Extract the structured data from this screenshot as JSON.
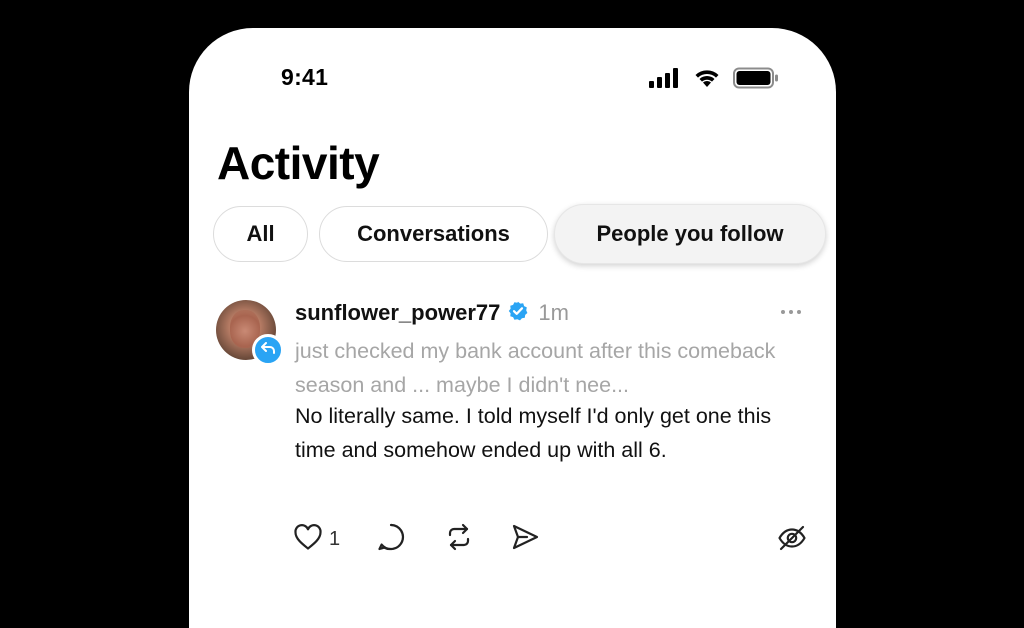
{
  "status_bar": {
    "time": "9:41",
    "icons": [
      "cellular-signal-icon",
      "wifi-icon",
      "battery-icon"
    ]
  },
  "page": {
    "title": "Activity"
  },
  "filters": [
    {
      "label": "All",
      "selected": false
    },
    {
      "label": "Conversations",
      "selected": false
    },
    {
      "label": "People you follow",
      "selected": true
    }
  ],
  "post": {
    "username": "sunflower_power77",
    "verified": true,
    "timestamp": "1m",
    "quoted_text": "just checked my bank account after this comeback season and ... maybe I didn't nee...",
    "reply_text": "No literally same. I told myself I'd only get one this time and somehow ended up with all 6.",
    "like_count": "1",
    "badge_icon": "reply-icon"
  },
  "colors": {
    "verified_blue": "#2aa4f4",
    "muted_text": "#a6a6a6",
    "background": "#000000"
  }
}
